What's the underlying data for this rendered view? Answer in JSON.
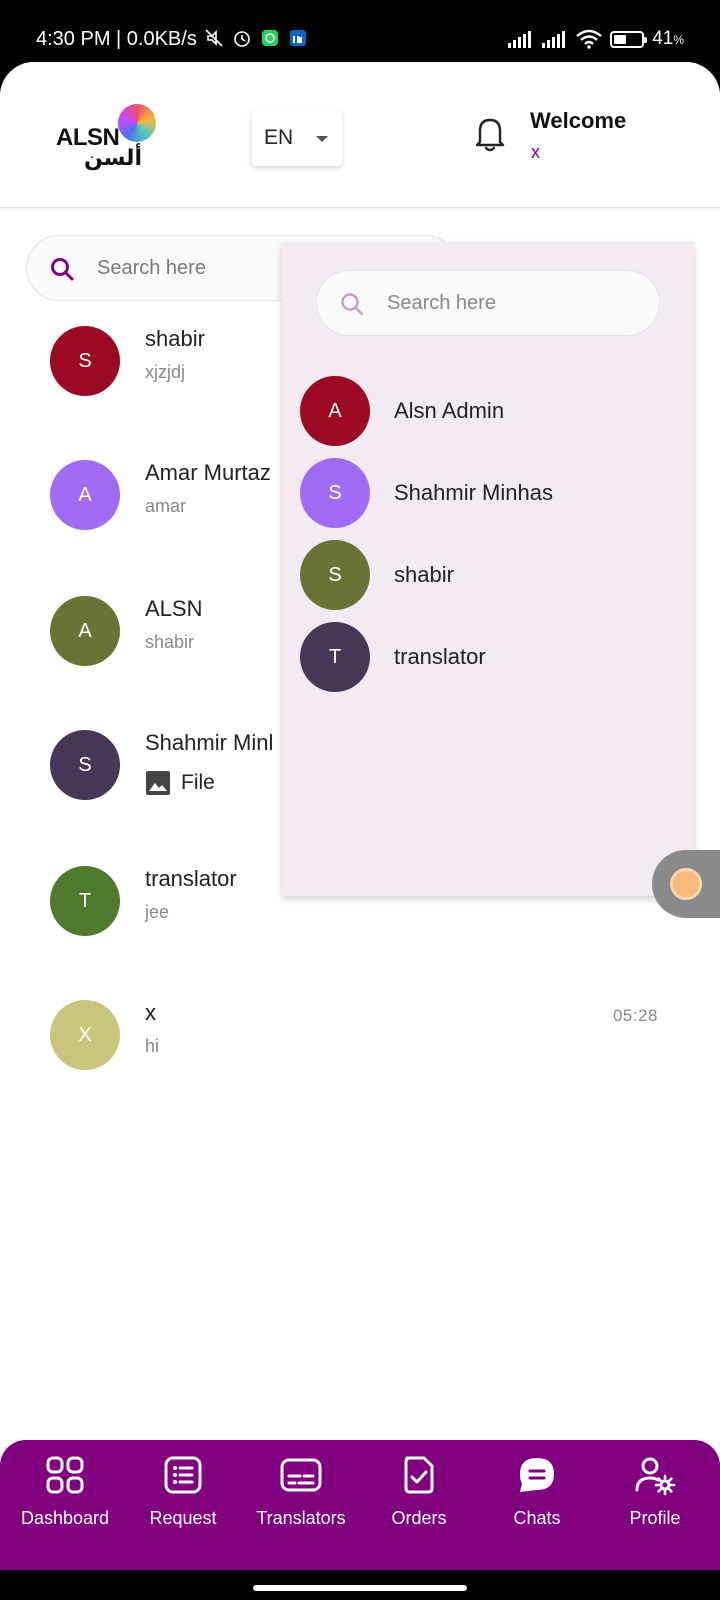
{
  "status_bar": {
    "time": "4:30 PM | 0.0KB/s",
    "battery": "41"
  },
  "header": {
    "logo_text": "ALSN",
    "logo_arabic": "ألسن",
    "language": "EN",
    "welcome": "Welcome",
    "user": "x"
  },
  "main": {
    "search_placeholder": "Search here",
    "chats": [
      {
        "initial": "S",
        "name": "shabir",
        "message": "xjzjdj",
        "time": "",
        "color": "#9b0a22"
      },
      {
        "initial": "A",
        "name": "Amar Murtaz",
        "message": "amar",
        "time": "",
        "color": "#a06cf5"
      },
      {
        "initial": "A",
        "name": "ALSN",
        "message": "shabir",
        "time": "",
        "color": "#6b7236"
      },
      {
        "initial": "S",
        "name": "Shahmir Minl",
        "message": "File",
        "time": "",
        "color": "#463657"
      },
      {
        "initial": "T",
        "name": "translator",
        "message": "jee",
        "time": "",
        "color": "#4f7a2d"
      },
      {
        "initial": "X",
        "name": "x",
        "message": "hi",
        "time": "05:28",
        "color": "#cbc47f"
      }
    ]
  },
  "dropdown": {
    "search_placeholder": "Search here",
    "items": [
      {
        "initial": "A",
        "name": "Alsn Admin",
        "color": "#9b0a22"
      },
      {
        "initial": "S",
        "name": "Shahmir Minhas",
        "color": "#a06cf5"
      },
      {
        "initial": "S",
        "name": "shabir",
        "color": "#6b7236"
      },
      {
        "initial": "T",
        "name": "translator",
        "color": "#463657"
      }
    ]
  },
  "bottom_nav": {
    "items": [
      {
        "label": "Dashboard",
        "icon": "dashboard-grid-icon"
      },
      {
        "label": "Request",
        "icon": "request-list-icon"
      },
      {
        "label": "Translators",
        "icon": "translators-card-icon"
      },
      {
        "label": "Orders",
        "icon": "orders-doc-icon"
      },
      {
        "label": "Chats",
        "icon": "chats-bubble-icon"
      },
      {
        "label": "Profile",
        "icon": "profile-gear-icon"
      }
    ]
  },
  "colors": {
    "brand": "#800080",
    "dropdown_bg": "#f3eaf3"
  }
}
